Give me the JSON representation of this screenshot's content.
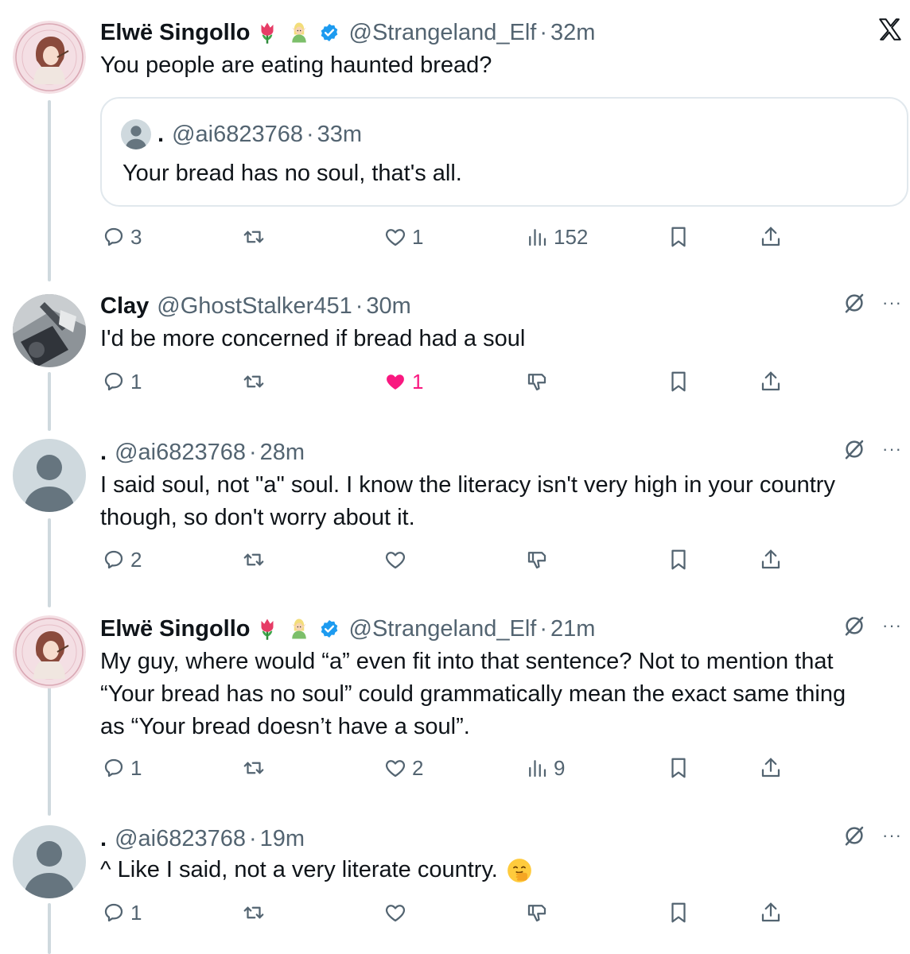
{
  "tweets": [
    {
      "name": "Elwë Singollo",
      "badges": [
        "tulip-emoji",
        "elf-emoji",
        "verified-badge"
      ],
      "handle": "@Strangeland_Elf",
      "time": "32m",
      "text": "You people are eating haunted bread?",
      "quote": {
        "name": ".",
        "handle": "@ai6823768",
        "time": "33m",
        "text": "Your bread has no soul, that's all."
      },
      "stats": {
        "replies": "3",
        "reposts": "",
        "likes": "1",
        "views": "152"
      }
    },
    {
      "name": "Clay",
      "handle": "@GhostStalker451",
      "time": "30m",
      "text": "I'd be more concerned if bread had a soul",
      "stats": {
        "replies": "1",
        "reposts": "",
        "likes": "1"
      },
      "liked": true
    },
    {
      "name": ".",
      "handle": "@ai6823768",
      "time": "28m",
      "lines": [
        "I said soul, not \"a\" soul. I know the literacy isn't very high in your country",
        "though, so don't worry about it."
      ],
      "stats": {
        "replies": "2",
        "reposts": "",
        "likes": ""
      }
    },
    {
      "name": "Elwë Singollo",
      "badges": [
        "tulip-emoji",
        "elf-emoji",
        "verified-badge"
      ],
      "handle": "@Strangeland_Elf",
      "time": "21m",
      "lines": [
        "My guy, where would “a” even fit into that sentence? Not to mention that",
        "“Your bread has no soul” could grammatically mean the exact same thing",
        "as “Your bread doesn’t have a soul”."
      ],
      "stats": {
        "replies": "1",
        "reposts": "",
        "likes": "2",
        "views": "9"
      }
    },
    {
      "name": ".",
      "handle": "@ai6823768",
      "time": "19m",
      "text": "^ Like I said, not a very literate country.",
      "emoji": "face-with-hand-over-mouth-emoji",
      "stats": {
        "replies": "1",
        "reposts": "",
        "likes": ""
      }
    }
  ],
  "separator": "·",
  "more_label": "···",
  "colors": {
    "text": "#0f1419",
    "secondary": "#536471",
    "verified": "#1d9bf0",
    "like": "#f91880",
    "thread_line": "#cfd9de",
    "border": "#e1e8ed"
  }
}
